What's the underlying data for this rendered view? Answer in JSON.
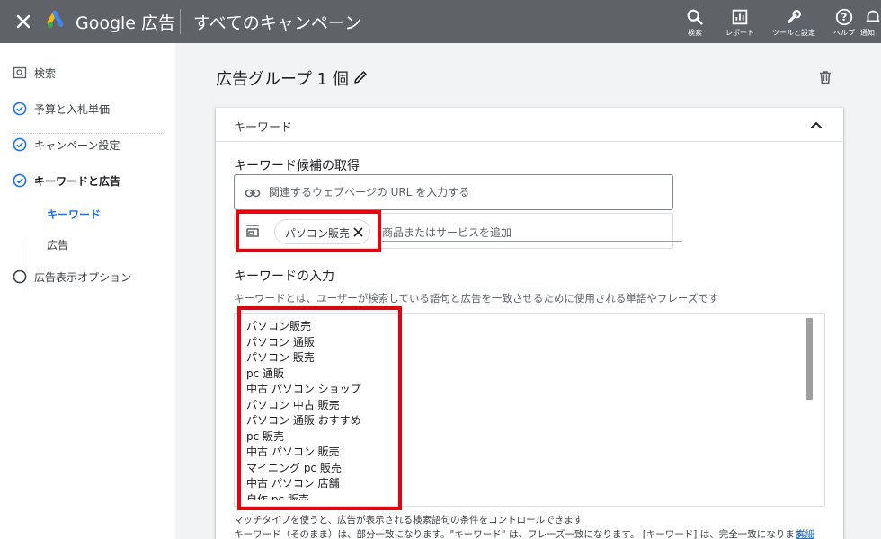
{
  "topbar": {
    "brand": "Google 広告",
    "page_title": "すべてのキャンペーン",
    "tools": [
      {
        "icon": "search-icon",
        "label": "検索"
      },
      {
        "icon": "report-icon",
        "label": "レポート"
      },
      {
        "icon": "wrench-icon",
        "label": "ツールと設定"
      },
      {
        "icon": "help-icon",
        "label": "ヘルプ"
      },
      {
        "icon": "bell-icon",
        "label": "通知"
      }
    ]
  },
  "sidebar": {
    "search": "検索",
    "steps": [
      {
        "label": "予算と入札単価",
        "status": "done"
      },
      {
        "label": "キャンペーン設定",
        "status": "done"
      },
      {
        "label": "キーワードと広告",
        "status": "done"
      },
      {
        "label": "広告表示オプション",
        "status": "pending"
      }
    ],
    "sub_items": [
      {
        "label": "キーワード",
        "active": true
      },
      {
        "label": "広告",
        "active": false
      }
    ]
  },
  "main": {
    "group_title": "広告グループ 1 個",
    "card_title": "キーワード",
    "candidates_label": "キーワード候補の取得",
    "url_placeholder": "関連するウェブページの URL を入力する",
    "product_chip": "パソコン販売",
    "product_placeholder": "商品またはサービスを追加",
    "keywords_label": "キーワードの入力",
    "keywords_desc": "キーワードとは、ユーザーが検索している語句と広告を一致させるために使用される単語やフレーズです",
    "keywords": [
      "パソコン販売",
      "パソコン 通販",
      "パソコン 販売",
      "pc 通販",
      "中古 パソコン ショップ",
      "パソコン 中古 販売",
      "パソコン 通販 おすすめ",
      "pc 販売",
      "中古 パソコン 販売",
      "マイニング pc 販売",
      "中古 パソコン 店舗",
      "自作 pc 販売"
    ],
    "footnote1": "マッチタイプを使うと、広告が表示される検索語句の条件をコントロールできます",
    "footnote2": "キーワード（そのまま）は、部分一致になります。\"キーワード\" は、フレーズ一致になります。 [キーワード] は、完全一致になります。",
    "detail_link": "詳細"
  },
  "colors": {
    "topbar": "#5f6368",
    "accent": "#1a73e8",
    "highlight": "#e8000b"
  }
}
